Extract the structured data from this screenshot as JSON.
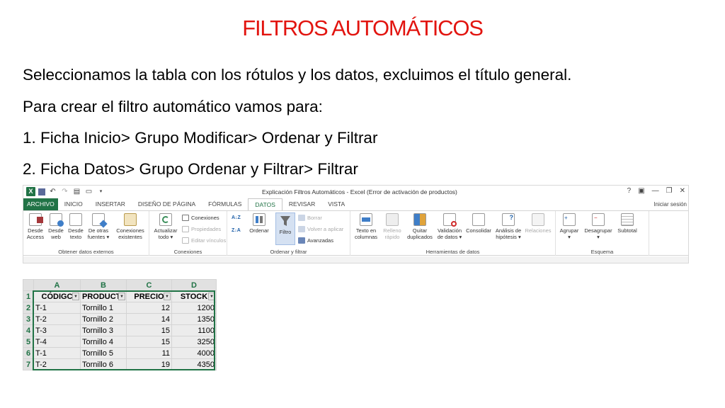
{
  "slide": {
    "title": "FILTROS AUTOMÁTICOS",
    "lines": [
      "Seleccionamos  la tabla con los rótulos y los datos, excluimos el título general.",
      "Para crear el filtro automático vamos para:",
      "1. Ficha Inicio> Grupo Modificar> Ordenar y Filtrar",
      "2. Ficha Datos> Grupo Ordenar y Filtrar> Filtrar"
    ]
  },
  "excel": {
    "window_title": "Explicación Filtros Automáticos - Excel (Error de activación de productos)",
    "window_controls": [
      "?",
      "▣",
      "—",
      "❐",
      "✕"
    ],
    "signin": "Iniciar sesión",
    "tabs": [
      "ARCHIVO",
      "INICIO",
      "INSERTAR",
      "DISEÑO DE PÁGINA",
      "FÓRMULAS",
      "DATOS",
      "REVISAR",
      "VISTA"
    ],
    "active_tab": "DATOS",
    "groups": {
      "obtener": {
        "label": "Obtener datos externos",
        "buttons": [
          {
            "l1": "Desde",
            "l2": "Access"
          },
          {
            "l1": "Desde",
            "l2": "web"
          },
          {
            "l1": "Desde",
            "l2": "texto"
          },
          {
            "l1": "De otras",
            "l2": "fuentes ▾"
          },
          {
            "l1": "Conexiones",
            "l2": "existentes"
          }
        ]
      },
      "conexiones": {
        "label": "Conexiones",
        "refresh": {
          "l1": "Actualizar",
          "l2": "todo ▾"
        },
        "items": [
          "Conexiones",
          "Propiedades",
          "Editar vínculos"
        ]
      },
      "ordenar": {
        "label": "Ordenar y filtrar",
        "sort_az": "A↓Z",
        "sort_za": "Z↓A",
        "ordenar": "Ordenar",
        "filtro": "Filtro",
        "items": [
          "Borrar",
          "Volver a aplicar",
          "Avanzadas"
        ]
      },
      "herramientas": {
        "label": "Herramientas de datos",
        "buttons": [
          {
            "l1": "Texto en",
            "l2": "columnas"
          },
          {
            "l1": "Relleno",
            "l2": "rápido"
          },
          {
            "l1": "Quitar",
            "l2": "duplicados"
          },
          {
            "l1": "Validación",
            "l2": "de datos ▾"
          },
          {
            "l1": "Consolidar",
            "l2": ""
          },
          {
            "l1": "Análisis de",
            "l2": "hipótesis ▾"
          },
          {
            "l1": "Relaciones",
            "l2": ""
          }
        ]
      },
      "esquema": {
        "label": "Esquema",
        "buttons": [
          {
            "l1": "Agrupar",
            "l2": "▾"
          },
          {
            "l1": "Desagrupar",
            "l2": "▾"
          },
          {
            "l1": "Subtotal",
            "l2": ""
          }
        ]
      }
    },
    "colors": {
      "excel_green": "#217346",
      "title_red": "#e2140f",
      "filtro_highlight": "#d5e1f2"
    }
  },
  "sheet": {
    "columns": [
      "A",
      "B",
      "C",
      "D"
    ],
    "headers": [
      "CÓDIGC",
      "PRODUCT",
      "PRECIO",
      "STOCK"
    ],
    "rows": [
      {
        "n": "2",
        "cells": [
          "T-1",
          "Tornillo 1",
          "12",
          "1200"
        ]
      },
      {
        "n": "3",
        "cells": [
          "T-2",
          "Tornillo 2",
          "14",
          "1350"
        ]
      },
      {
        "n": "4",
        "cells": [
          "T-3",
          "Tornillo 3",
          "15",
          "1100"
        ]
      },
      {
        "n": "5",
        "cells": [
          "T-4",
          "Tornillo 4",
          "15",
          "3250"
        ]
      },
      {
        "n": "6",
        "cells": [
          "T-1",
          "Tornillo 5",
          "11",
          "4000"
        ]
      },
      {
        "n": "7",
        "cells": [
          "T-2",
          "Tornillo 6",
          "19",
          "4350"
        ]
      }
    ],
    "header_row_number": "1"
  }
}
